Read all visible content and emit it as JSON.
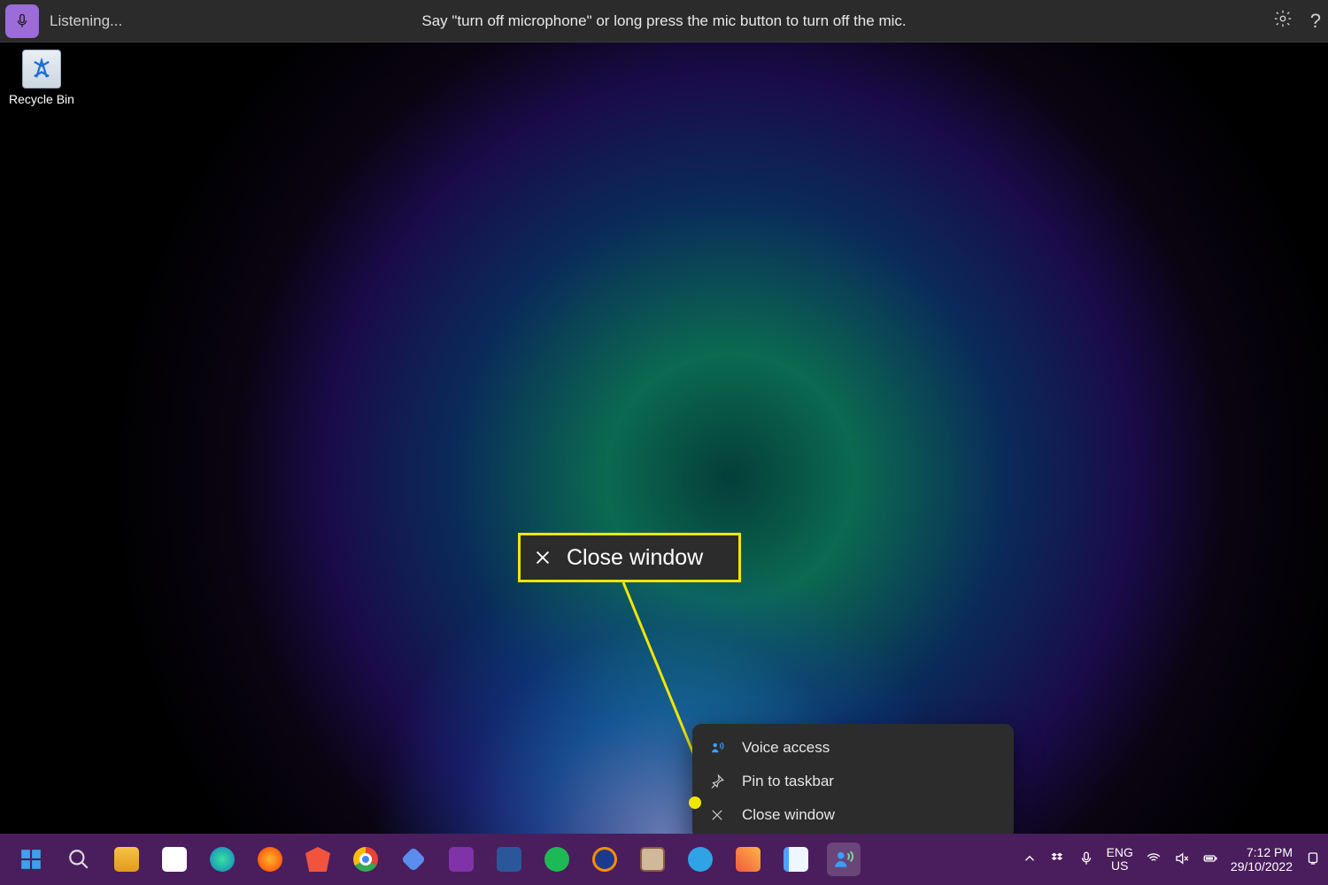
{
  "voice_bar": {
    "status": "Listening...",
    "hint": "Say \"turn off microphone\" or long press the mic button to turn off the mic."
  },
  "desktop": {
    "recycle_bin_label": "Recycle Bin"
  },
  "callout": {
    "label": "Close window"
  },
  "context_menu": {
    "items": [
      {
        "label": "Voice access",
        "icon": "voice-access-icon"
      },
      {
        "label": "Pin to taskbar",
        "icon": "pin-icon"
      },
      {
        "label": "Close window",
        "icon": "close-icon"
      }
    ]
  },
  "taskbar": {
    "apps": [
      {
        "name": "start",
        "color": "#3ea0ef"
      },
      {
        "name": "search",
        "color": "#dcdcdc"
      },
      {
        "name": "file-explorer",
        "color": "#f6c445"
      },
      {
        "name": "notion",
        "color": "#ffffff"
      },
      {
        "name": "edge",
        "color": "#2aa8d8"
      },
      {
        "name": "firefox",
        "color": "#ff7d2d"
      },
      {
        "name": "brave",
        "color": "#f0543c"
      },
      {
        "name": "chrome",
        "color": "#ffffff"
      },
      {
        "name": "todo",
        "color": "#5a8dee"
      },
      {
        "name": "onenote",
        "color": "#8033a8"
      },
      {
        "name": "word",
        "color": "#2b579a"
      },
      {
        "name": "spotify",
        "color": "#1db954"
      },
      {
        "name": "audacity",
        "color": "#1b3a8f"
      },
      {
        "name": "clipboard",
        "color": "#8a5a44"
      },
      {
        "name": "telegram",
        "color": "#30a3e6"
      },
      {
        "name": "powertoys",
        "color": "#f05a3c"
      },
      {
        "name": "notepad",
        "color": "#4da3ff"
      },
      {
        "name": "voice-access",
        "color": "#3aa0ff"
      }
    ],
    "language": {
      "line1": "ENG",
      "line2": "US"
    },
    "clock": {
      "time": "7:12 PM",
      "date": "29/10/2022"
    }
  }
}
